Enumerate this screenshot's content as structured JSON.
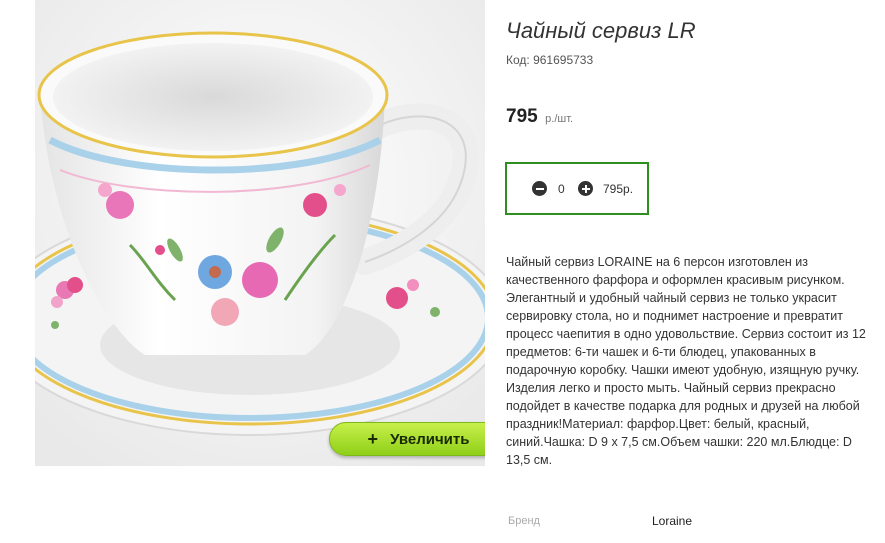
{
  "product": {
    "title": "Чайный сервиз LR",
    "code": "Код: 961695733",
    "price": "795",
    "price_unit": "р./шт.",
    "description": "Чайный сервиз LORAINE на 6 персон изготовлен из качественного фарфора и оформлен красивым рисунком. Элегантный и удобный чайный сервиз не только украсит сервировку стола, но и поднимет настроение и превратит процесс чаепития в одно удовольствие. Сервиз состоит из 12 предметов: 6-ти чашек и 6-ти блюдец, упакованных в подарочную коробку. Чашки имеют удобную, изящную ручку. Изделия легко и просто мыть. Чайный сервиз прекрасно подойдет в качестве подарка для родных и друзей на любой праздник!Материал: фарфор.Цвет: белый, красный, синий.Чашка: D 9 х 7,5 см.Объем чашки: 220 мл.Блюдце: D 13,5 см."
  },
  "cart": {
    "quantity": "0",
    "sum": "795р.",
    "border_color": "#2d8f1e"
  },
  "image": {
    "zoom_label": "Увеличить",
    "zoom_icon": "plus-icon",
    "accent": "#9ad62a"
  },
  "specs": {
    "brand_label": "Бренд",
    "brand_value": "Loraine"
  }
}
